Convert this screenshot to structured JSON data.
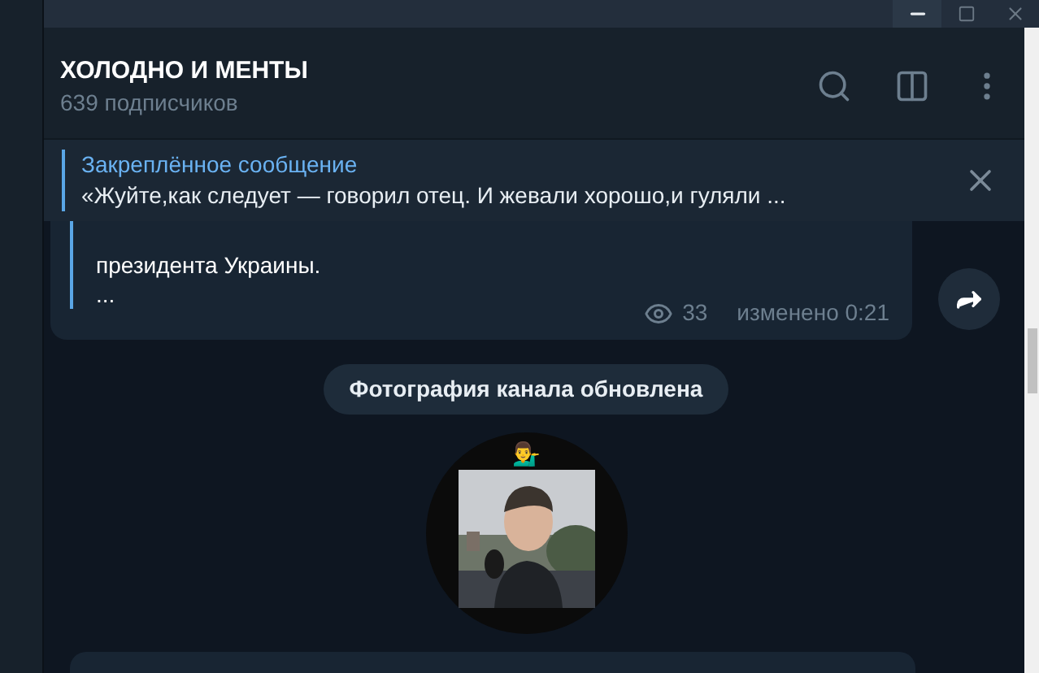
{
  "header": {
    "title": "ХОЛОДНО И МЕНТЫ",
    "subtitle": "639 подписчиков"
  },
  "pinned": {
    "label": "Закреплённое сообщение",
    "text": "«Жуйте,как следует — говорил отец. И жевали хорошо,и гуляли ..."
  },
  "message": {
    "lines": [
      "президента Украины.",
      "..."
    ],
    "views": "33",
    "time": "изменено 0:21"
  },
  "service": {
    "text": "Фотография канала обновлена"
  },
  "channel_photo": {
    "kind": "picture",
    "emoji": "💁‍♂️"
  }
}
